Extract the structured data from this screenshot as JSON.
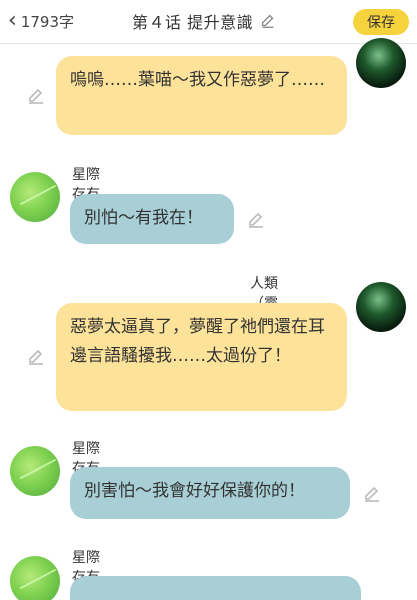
{
  "header": {
    "word_count": "1793字",
    "title": "第４话 提升意識",
    "save_label": "保存"
  },
  "messages": [
    {
      "speaker": "",
      "text": "嗚嗚……葉喵～我又作惡夢了……",
      "side": "right"
    },
    {
      "speaker": "星際存有（葉喵）",
      "text": "別怕～有我在！",
      "side": "left"
    },
    {
      "speaker": "人類（靈兒）",
      "text": "惡夢太逼真了，夢醒了祂們還在耳邊言語騷擾我……太過份了！",
      "side": "right"
    },
    {
      "speaker": "星際存有（葉喵）",
      "text": "別害怕～我會好好保護你的！",
      "side": "left"
    },
    {
      "speaker": "星際存有（葉喵）",
      "text": "",
      "side": "left"
    }
  ],
  "colors": {
    "user_bubble": "#fde39a",
    "bot_bubble": "#a9cfd6",
    "save_button": "#f6d23c"
  },
  "icons": {
    "back": "chevron-left-icon",
    "edit": "pencil-icon"
  }
}
